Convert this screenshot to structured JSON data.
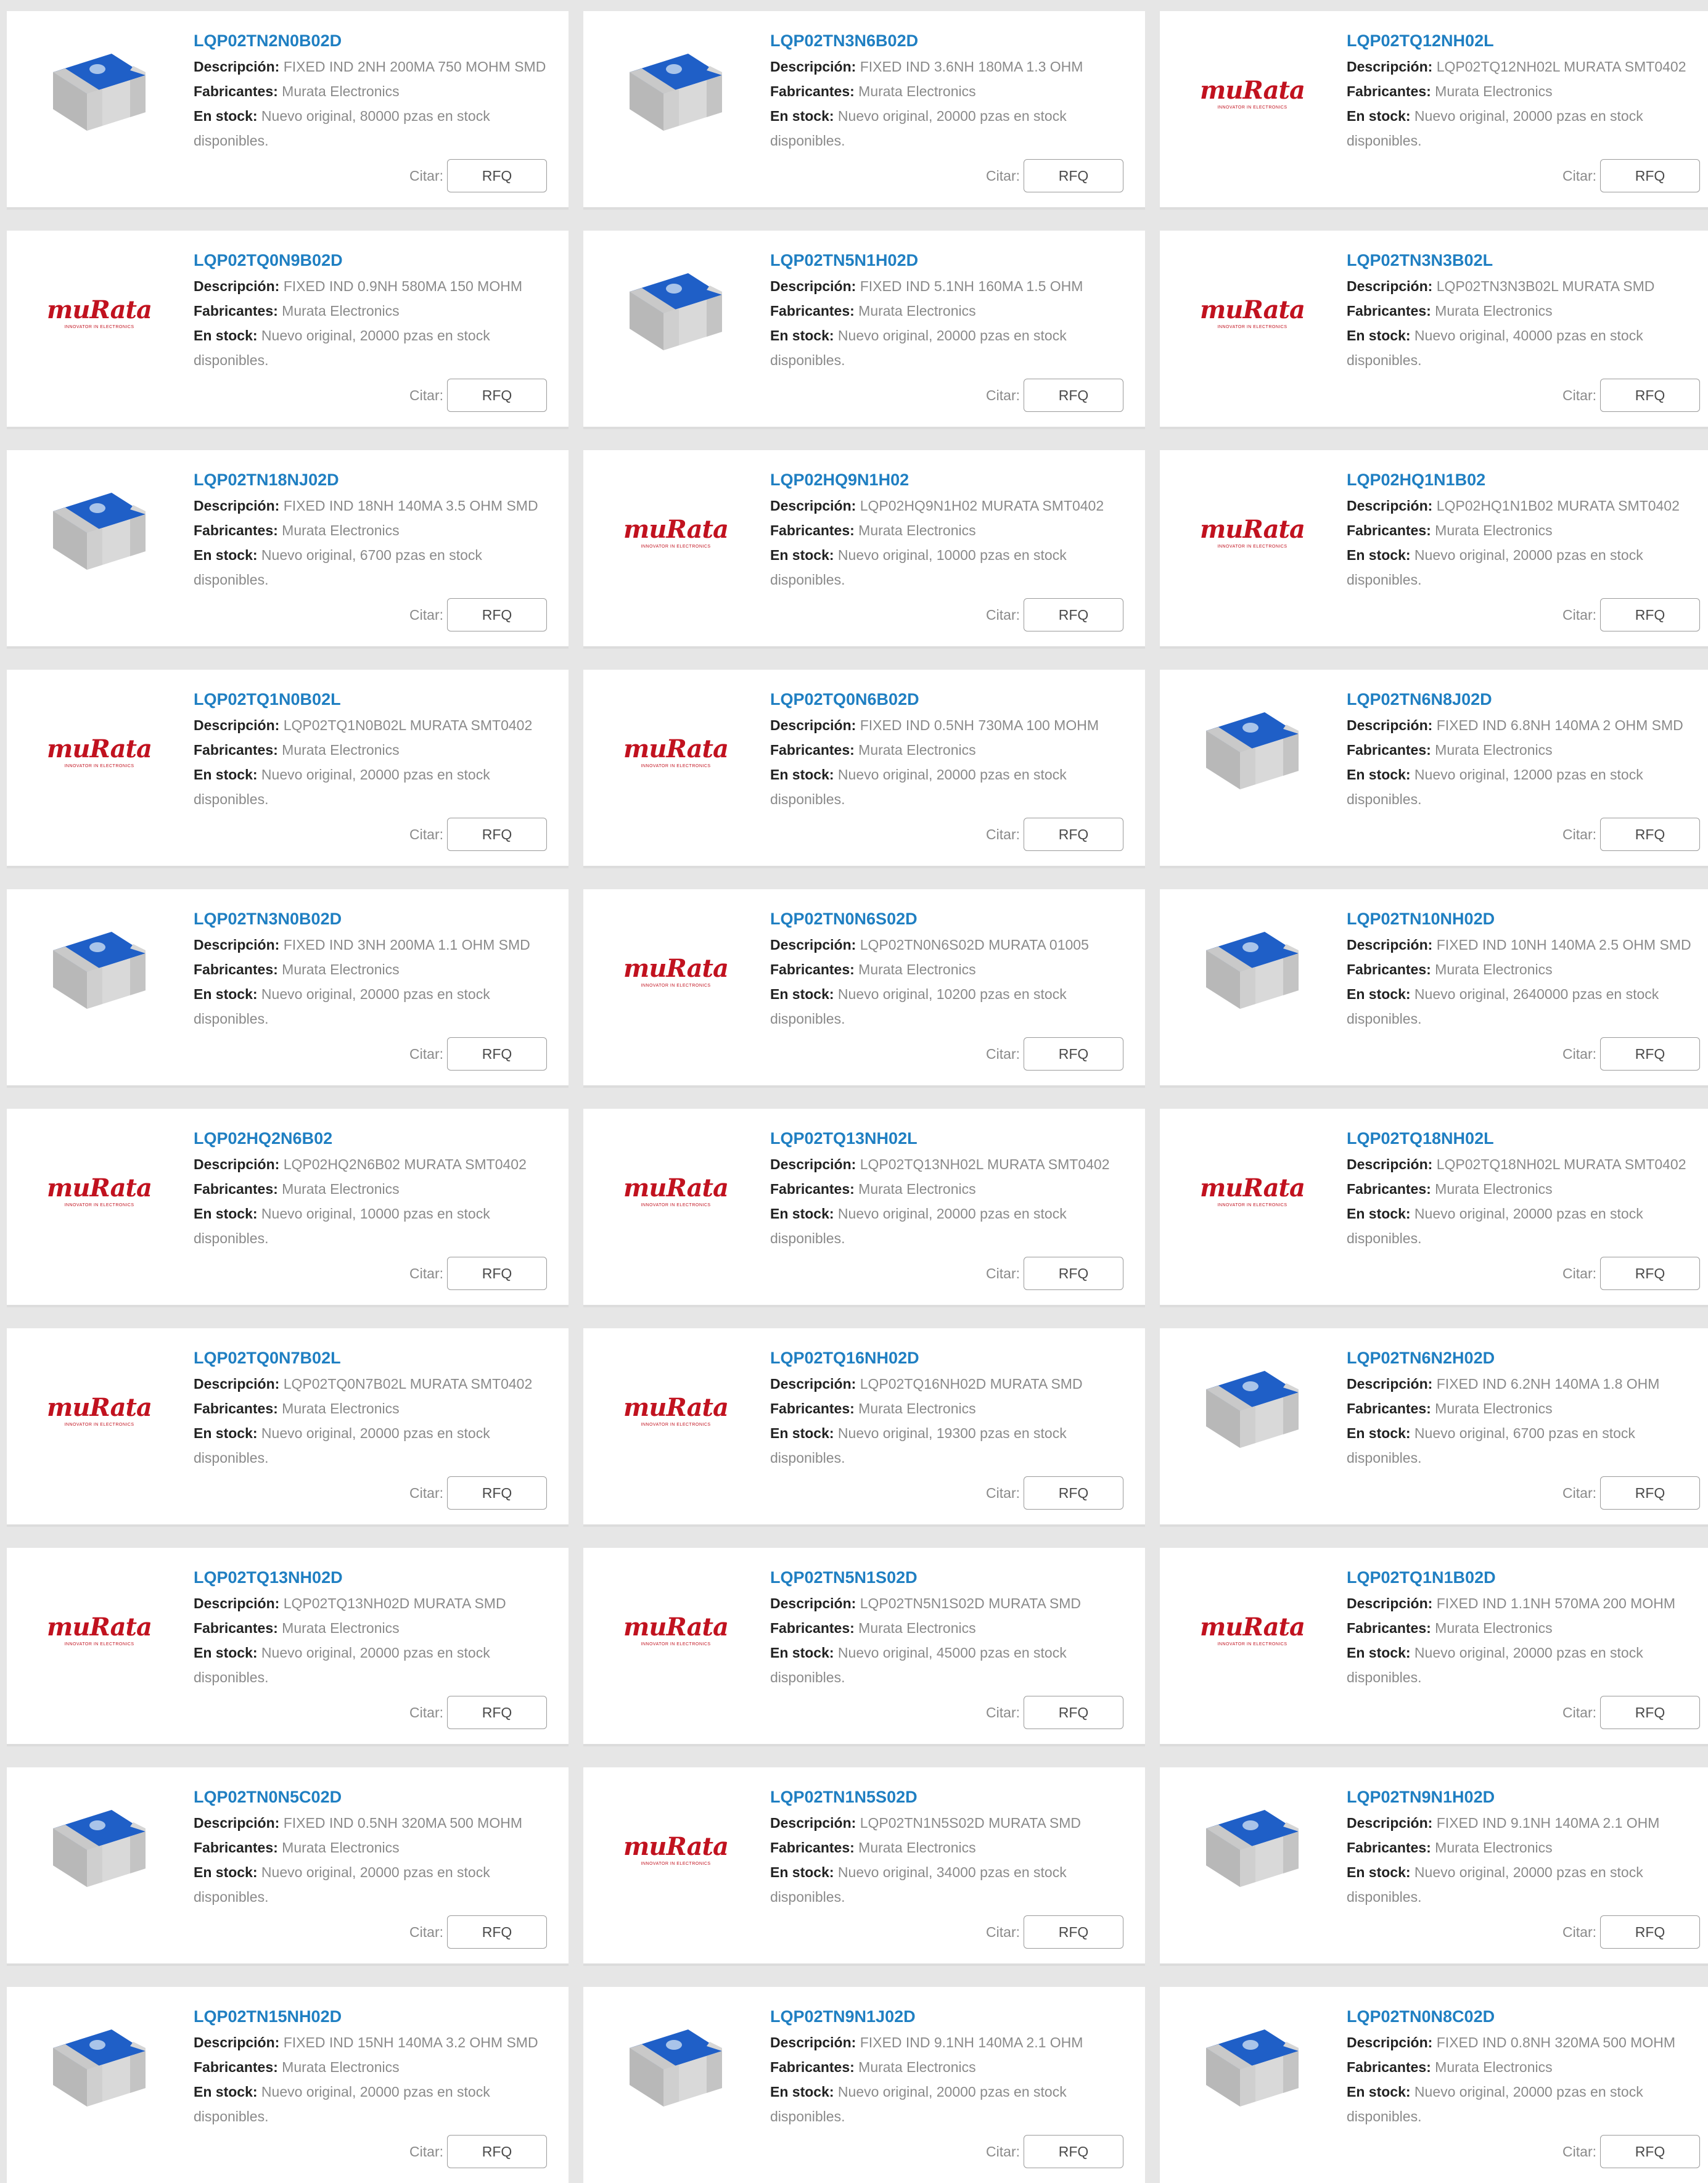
{
  "labels": {
    "description": "Descripción:",
    "manufacturer": "Fabricantes:",
    "stock": "En stock:",
    "quote": "Citar:",
    "rfq": "RFQ"
  },
  "logo": {
    "brand": "muRata",
    "tagline": "INNOVATOR IN ELECTRONICS",
    "color": "#c1121f"
  },
  "colors": {
    "link": "#1f7fc2",
    "chip_top": "#1f5fc7",
    "chip_body": "#c9c9c9"
  },
  "products": [
    {
      "pn": "LQP02TN2N0B02D",
      "desc": "FIXED IND 2NH 200MA 750 MOHM SMD",
      "mfr": "Murata Electronics",
      "stock": "Nuevo original, 80000 pzas en stock disponibles.",
      "img": "chip-icon"
    },
    {
      "pn": "LQP02TN3N6B02D",
      "desc": "FIXED IND 3.6NH 180MA 1.3 OHM",
      "mfr": "Murata Electronics",
      "stock": "Nuevo original, 20000 pzas en stock disponibles.",
      "img": "chip-icon"
    },
    {
      "pn": "LQP02TQ12NH02L",
      "desc": "LQP02TQ12NH02L MURATA SMT0402",
      "mfr": "Murata Electronics",
      "stock": "Nuevo original, 20000 pzas en stock disponibles.",
      "img": "murata-logo"
    },
    {
      "pn": "LQP02TQ0N9B02D",
      "desc": "FIXED IND 0.9NH 580MA 150 MOHM",
      "mfr": "Murata Electronics",
      "stock": "Nuevo original, 20000 pzas en stock disponibles.",
      "img": "murata-logo"
    },
    {
      "pn": "LQP02TN5N1H02D",
      "desc": "FIXED IND 5.1NH 160MA 1.5 OHM",
      "mfr": "Murata Electronics",
      "stock": "Nuevo original, 20000 pzas en stock disponibles.",
      "img": "chip-icon"
    },
    {
      "pn": "LQP02TN3N3B02L",
      "desc": "LQP02TN3N3B02L MURATA SMD",
      "mfr": "Murata Electronics",
      "stock": "Nuevo original, 40000 pzas en stock disponibles.",
      "img": "murata-logo"
    },
    {
      "pn": "LQP02TN18NJ02D",
      "desc": "FIXED IND 18NH 140MA 3.5 OHM SMD",
      "mfr": "Murata Electronics",
      "stock": "Nuevo original, 6700 pzas en stock disponibles.",
      "img": "chip-icon"
    },
    {
      "pn": "LQP02HQ9N1H02",
      "desc": "LQP02HQ9N1H02 MURATA SMT0402",
      "mfr": "Murata Electronics",
      "stock": "Nuevo original, 10000 pzas en stock disponibles.",
      "img": "murata-logo"
    },
    {
      "pn": "LQP02HQ1N1B02",
      "desc": "LQP02HQ1N1B02 MURATA SMT0402",
      "mfr": "Murata Electronics",
      "stock": "Nuevo original, 20000 pzas en stock disponibles.",
      "img": "murata-logo"
    },
    {
      "pn": "LQP02TQ1N0B02L",
      "desc": "LQP02TQ1N0B02L MURATA SMT0402",
      "mfr": "Murata Electronics",
      "stock": "Nuevo original, 20000 pzas en stock disponibles.",
      "img": "murata-logo"
    },
    {
      "pn": "LQP02TQ0N6B02D",
      "desc": "FIXED IND 0.5NH 730MA 100 MOHM",
      "mfr": "Murata Electronics",
      "stock": "Nuevo original, 20000 pzas en stock disponibles.",
      "img": "murata-logo"
    },
    {
      "pn": "LQP02TN6N8J02D",
      "desc": "FIXED IND 6.8NH 140MA 2 OHM SMD",
      "mfr": "Murata Electronics",
      "stock": "Nuevo original, 12000 pzas en stock disponibles.",
      "img": "chip-icon"
    },
    {
      "pn": "LQP02TN3N0B02D",
      "desc": "FIXED IND 3NH 200MA 1.1 OHM SMD",
      "mfr": "Murata Electronics",
      "stock": "Nuevo original, 20000 pzas en stock disponibles.",
      "img": "chip-icon"
    },
    {
      "pn": "LQP02TN0N6S02D",
      "desc": "LQP02TN0N6S02D MURATA 01005",
      "mfr": "Murata Electronics",
      "stock": "Nuevo original, 10200 pzas en stock disponibles.",
      "img": "murata-logo"
    },
    {
      "pn": "LQP02TN10NH02D",
      "desc": "FIXED IND 10NH 140MA 2.5 OHM SMD",
      "mfr": "Murata Electronics",
      "stock": "Nuevo original, 2640000 pzas en stock disponibles.",
      "img": "chip-icon"
    },
    {
      "pn": "LQP02HQ2N6B02",
      "desc": "LQP02HQ2N6B02 MURATA SMT0402",
      "mfr": "Murata Electronics",
      "stock": "Nuevo original, 10000 pzas en stock disponibles.",
      "img": "murata-logo"
    },
    {
      "pn": "LQP02TQ13NH02L",
      "desc": "LQP02TQ13NH02L MURATA SMT0402",
      "mfr": "Murata Electronics",
      "stock": "Nuevo original, 20000 pzas en stock disponibles.",
      "img": "murata-logo"
    },
    {
      "pn": "LQP02TQ18NH02L",
      "desc": "LQP02TQ18NH02L MURATA SMT0402",
      "mfr": "Murata Electronics",
      "stock": "Nuevo original, 20000 pzas en stock disponibles.",
      "img": "murata-logo"
    },
    {
      "pn": "LQP02TQ0N7B02L",
      "desc": "LQP02TQ0N7B02L MURATA SMT0402",
      "mfr": "Murata Electronics",
      "stock": "Nuevo original, 20000 pzas en stock disponibles.",
      "img": "murata-logo"
    },
    {
      "pn": "LQP02TQ16NH02D",
      "desc": "LQP02TQ16NH02D MURATA SMD",
      "mfr": "Murata Electronics",
      "stock": "Nuevo original, 19300 pzas en stock disponibles.",
      "img": "murata-logo"
    },
    {
      "pn": "LQP02TN6N2H02D",
      "desc": "FIXED IND 6.2NH 140MA 1.8 OHM",
      "mfr": "Murata Electronics",
      "stock": "Nuevo original, 6700 pzas en stock disponibles.",
      "img": "chip-icon"
    },
    {
      "pn": "LQP02TQ13NH02D",
      "desc": "LQP02TQ13NH02D MURATA SMD",
      "mfr": "Murata Electronics",
      "stock": "Nuevo original, 20000 pzas en stock disponibles.",
      "img": "murata-logo"
    },
    {
      "pn": "LQP02TN5N1S02D",
      "desc": "LQP02TN5N1S02D MURATA SMD",
      "mfr": "Murata Electronics",
      "stock": "Nuevo original, 45000 pzas en stock disponibles.",
      "img": "murata-logo"
    },
    {
      "pn": "LQP02TQ1N1B02D",
      "desc": "FIXED IND 1.1NH 570MA 200 MOHM",
      "mfr": "Murata Electronics",
      "stock": "Nuevo original, 20000 pzas en stock disponibles.",
      "img": "murata-logo"
    },
    {
      "pn": "LQP02TN0N5C02D",
      "desc": "FIXED IND 0.5NH 320MA 500 MOHM",
      "mfr": "Murata Electronics",
      "stock": "Nuevo original, 20000 pzas en stock disponibles.",
      "img": "chip-icon"
    },
    {
      "pn": "LQP02TN1N5S02D",
      "desc": "LQP02TN1N5S02D MURATA SMD",
      "mfr": "Murata Electronics",
      "stock": "Nuevo original, 34000 pzas en stock disponibles.",
      "img": "murata-logo"
    },
    {
      "pn": "LQP02TN9N1H02D",
      "desc": "FIXED IND 9.1NH 140MA 2.1 OHM",
      "mfr": "Murata Electronics",
      "stock": "Nuevo original, 20000 pzas en stock disponibles.",
      "img": "chip-icon"
    },
    {
      "pn": "LQP02TN15NH02D",
      "desc": "FIXED IND 15NH 140MA 3.2 OHM SMD",
      "mfr": "Murata Electronics",
      "stock": "Nuevo original, 20000 pzas en stock disponibles.",
      "img": "chip-icon"
    },
    {
      "pn": "LQP02TN9N1J02D",
      "desc": "FIXED IND 9.1NH 140MA 2.1 OHM",
      "mfr": "Murata Electronics",
      "stock": "Nuevo original, 20000 pzas en stock disponibles.",
      "img": "chip-icon"
    },
    {
      "pn": "LQP02TN0N8C02D",
      "desc": "FIXED IND 0.8NH 320MA 500 MOHM",
      "mfr": "Murata Electronics",
      "stock": "Nuevo original, 20000 pzas en stock disponibles.",
      "img": "chip-icon"
    }
  ]
}
